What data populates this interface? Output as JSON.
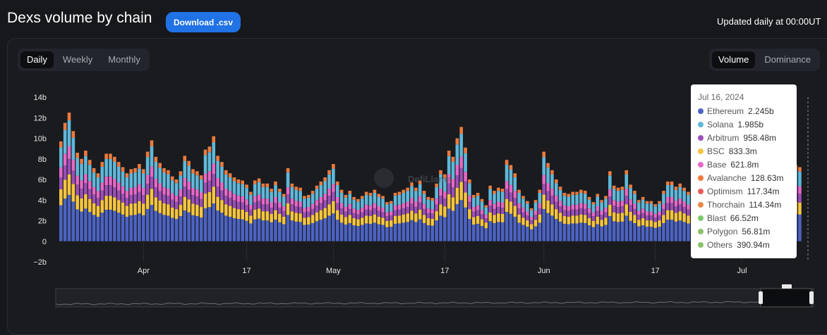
{
  "header": {
    "title": "Dexs volume by chain",
    "download_label": "Download .csv",
    "updated": "Updated daily at 00:00UT"
  },
  "period_tabs": [
    {
      "label": "Daily",
      "active": true
    },
    {
      "label": "Weekly",
      "active": false
    },
    {
      "label": "Monthly",
      "active": false
    }
  ],
  "metric_tabs": [
    {
      "label": "Volume",
      "active": true
    },
    {
      "label": "Dominance",
      "active": false
    }
  ],
  "watermark": {
    "text": "DefiLlama"
  },
  "colors": {
    "Ethereum": "#4c63c2",
    "Solana": "#5fb8da",
    "Arbitrum": "#9b4fb8",
    "BSC": "#f5c542",
    "Base": "#e668c8",
    "Avalanche": "#ec7a3d",
    "Optimism": "#e85a5a",
    "Thorchain": "#e8894a",
    "Blast": "#7ec86a",
    "Polygon": "#8cc26a",
    "Others": "#8cc26a"
  },
  "tooltip": {
    "date": "Jul 16, 2024",
    "rows": [
      {
        "name": "Ethereum",
        "value": "2.245b"
      },
      {
        "name": "Solana",
        "value": "1.985b"
      },
      {
        "name": "Arbitrum",
        "value": "958.48m"
      },
      {
        "name": "BSC",
        "value": "833.3m"
      },
      {
        "name": "Base",
        "value": "621.8m"
      },
      {
        "name": "Avalanche",
        "value": "128.63m"
      },
      {
        "name": "Optimism",
        "value": "117.34m"
      },
      {
        "name": "Thorchain",
        "value": "114.34m"
      },
      {
        "name": "Blast",
        "value": "66.52m"
      },
      {
        "name": "Polygon",
        "value": "56.81m"
      },
      {
        "name": "Others",
        "value": "390.94m"
      }
    ]
  },
  "chart_data": {
    "type": "bar",
    "stacked": true,
    "y_ticks": [
      "14b",
      "12b",
      "10b",
      "8b",
      "6b",
      "4b",
      "2b",
      "0",
      "−2b"
    ],
    "ylim": [
      -2,
      14
    ],
    "y_unit": "b",
    "x_tick_labels": [
      {
        "label": "Apr",
        "index": 20
      },
      {
        "label": "17",
        "index": 45
      },
      {
        "label": "May",
        "index": 66
      },
      {
        "label": "17",
        "index": 93
      },
      {
        "label": "Jun",
        "index": 117
      },
      {
        "label": "17",
        "index": 144
      },
      {
        "label": "Jul",
        "index": 165
      }
    ],
    "grid": false,
    "legend": "tooltip",
    "series_names": [
      "Ethereum",
      "BSC",
      "Arbitrum",
      "Base",
      "Solana",
      "Avalanche"
    ],
    "totals": [
      9.7,
      11.5,
      12.5,
      10.7,
      8.6,
      8.0,
      8.8,
      7.9,
      7.1,
      6.6,
      7.7,
      8.5,
      8.5,
      8.2,
      7.7,
      7.2,
      6.6,
      7.0,
      7.1,
      7.5,
      7.0,
      8.7,
      9.8,
      8.2,
      7.6,
      7.1,
      6.9,
      6.3,
      6.0,
      6.8,
      8.3,
      7.8,
      7.0,
      6.8,
      6.4,
      8.9,
      9.2,
      10.2,
      8.3,
      7.7,
      6.9,
      6.6,
      6.2,
      6.0,
      5.9,
      5.5,
      4.8,
      5.9,
      6.1,
      5.6,
      5.6,
      5.1,
      5.8,
      5.1,
      4.6,
      7.1,
      5.6,
      5.3,
      5.2,
      4.4,
      4.5,
      4.9,
      5.4,
      5.8,
      6.2,
      6.9,
      7.5,
      5.8,
      5.0,
      4.5,
      4.9,
      4.3,
      4.1,
      4.4,
      4.8,
      4.7,
      5.0,
      4.6,
      4.4,
      3.8,
      3.9,
      4.7,
      4.8,
      5.0,
      5.2,
      5.7,
      5.2,
      5.9,
      4.9,
      4.3,
      4.2,
      5.6,
      6.9,
      6.5,
      8.8,
      8.2,
      10.0,
      11.1,
      9.1,
      6.0,
      4.5,
      4.7,
      4.1,
      3.5,
      5.4,
      4.9,
      5.2,
      5.1,
      7.9,
      7.4,
      6.6,
      5.0,
      4.4,
      3.9,
      3.2,
      4.0,
      5.0,
      8.7,
      7.6,
      6.9,
      6.0,
      5.3,
      4.7,
      4.6,
      4.8,
      4.8,
      5.0,
      4.9,
      4.3,
      3.8,
      4.6,
      4.0,
      4.4,
      6.8,
      5.4,
      5.2,
      5.3,
      6.9,
      5.5,
      4.9,
      4.0,
      4.3,
      3.9,
      3.9,
      3.6,
      3.9,
      4.9,
      5.8,
      5.8,
      5.3,
      5.6,
      5.2,
      4.8,
      4.5,
      4.6,
      4.0,
      4.8,
      4.8,
      4.4,
      3.5,
      3.8,
      4.6,
      4.1,
      4.6,
      4.9,
      5.2,
      4.9,
      4.4,
      4.7,
      5.5,
      5.3,
      5.6,
      5.5,
      5.5,
      6.5,
      7.2,
      7.4,
      7.5,
      7.4,
      7.2
    ]
  }
}
